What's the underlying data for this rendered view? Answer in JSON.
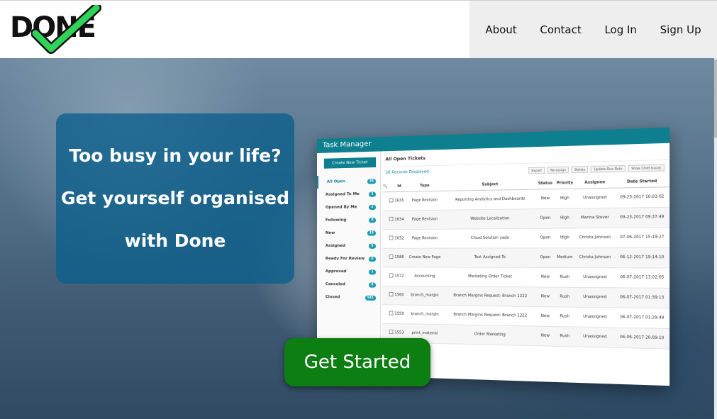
{
  "logo": {
    "text": "DONE",
    "icon": "green-checkmark"
  },
  "nav": {
    "about": "About",
    "contact": "Contact",
    "login": "Log In",
    "signup": "Sign Up"
  },
  "hero": {
    "line1": "Too busy in your life?",
    "line2": "Get yourself organised",
    "line3": "with Done",
    "cta": "Get Started"
  },
  "colors": {
    "accent_green": "#0d7f12",
    "panel_blue": "#0a5f8c",
    "teal": "#0d7f8f",
    "check_green": "#2fd35a"
  },
  "task_manager": {
    "title": "Task Manager",
    "create_button": "Create New Ticket",
    "heading": "All Open Tickets",
    "records": "26 Records Displayed",
    "tools": [
      "Export",
      "Re-assign",
      "Delete",
      "Update Due Date",
      "Show Child Issues"
    ],
    "sidebar": [
      {
        "label": "All Open",
        "count": "26"
      },
      {
        "label": "Assigned To Me",
        "count": "2"
      },
      {
        "label": "Opened By Me",
        "count": "2"
      },
      {
        "label": "Following",
        "count": "0"
      },
      {
        "label": "New",
        "count": "15"
      },
      {
        "label": "Assigned",
        "count": "5"
      },
      {
        "label": "Ready For Review",
        "count": "0"
      },
      {
        "label": "Approved",
        "count": "1"
      },
      {
        "label": "Canceled",
        "count": "0"
      },
      {
        "label": "Closed",
        "count": "541"
      }
    ],
    "columns": [
      "Id",
      "Type",
      "Subject",
      "Status",
      "Priority",
      "Assignee",
      "Date Started"
    ],
    "rows": [
      {
        "id": "1635",
        "type": "Page Revision",
        "subject": "Reporting Analytics and Dashboards",
        "status": "New",
        "priority": "High",
        "assignee": "Unassigned",
        "date": "09-23-2017 10:03:02"
      },
      {
        "id": "1634",
        "type": "Page Revision",
        "subject": "Website Localization",
        "status": "Open",
        "priority": "High",
        "assignee": "Marina Stever",
        "date": "09-23-2017 09:37:49"
      },
      {
        "id": "1632",
        "type": "Page Revision",
        "subject": "Cloud Solution yada",
        "status": "Open",
        "priority": "High",
        "assignee": "Christa Johnson",
        "date": "07-06-2017 15:19:27"
      },
      {
        "id": "1586",
        "type": "Create New Page",
        "subject": "Test Assigned To",
        "status": "Open",
        "priority": "Medium",
        "assignee": "Christa Johnson",
        "date": "06-12-2017 19:14:10"
      },
      {
        "id": "1572",
        "type": "Accounting",
        "subject": "Marketing Order Ticket",
        "status": "New",
        "priority": "Rush",
        "assignee": "Unassigned",
        "date": "06-07-2017 13:02:05"
      },
      {
        "id": "1560",
        "type": "branch_margin",
        "subject": "Branch Margins Request: Branch 1222",
        "status": "New",
        "priority": "Rush",
        "assignee": "Unassigned",
        "date": "06-07-2017 01:39:13"
      },
      {
        "id": "1559",
        "type": "branch_margin",
        "subject": "Branch Margins Request: Branch 1222",
        "status": "New",
        "priority": "Rush",
        "assignee": "Unassigned",
        "date": "06-07-2017 01:29:49"
      },
      {
        "id": "1553",
        "type": "print_material",
        "subject": "Order Marketing",
        "status": "New",
        "priority": "Rush",
        "assignee": "Unassigned",
        "date": "06-06-2017 20:09:10"
      }
    ]
  }
}
